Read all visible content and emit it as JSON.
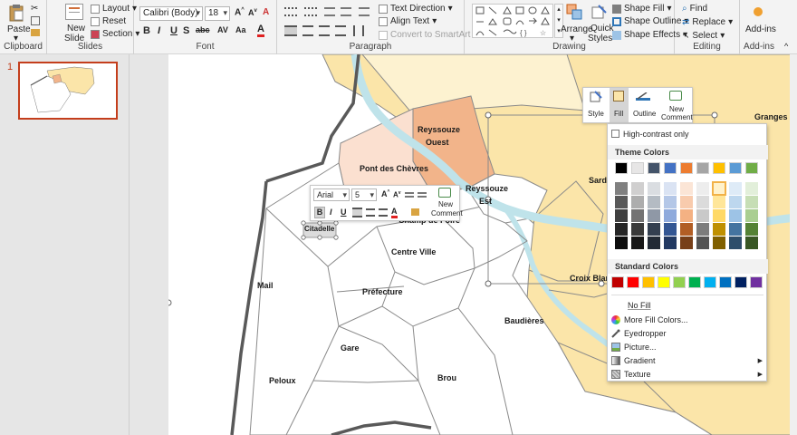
{
  "ribbon": {
    "clipboard": {
      "label": "Clipboard",
      "paste": "Paste"
    },
    "slides": {
      "label": "Slides",
      "new_slide_1": "New",
      "new_slide_2": "Slide",
      "layout": "Layout",
      "reset": "Reset",
      "section": "Section"
    },
    "font": {
      "label": "Font",
      "font_name": "Calibri (Body)",
      "font_size": "18"
    },
    "paragraph": {
      "label": "Paragraph",
      "text_direction": "Text Direction",
      "align_text": "Align Text",
      "convert_smartart": "Convert to SmartArt"
    },
    "drawing": {
      "label": "Drawing",
      "arrange": "Arrange",
      "quick_styles_1": "Quick",
      "quick_styles_2": "Styles",
      "shape_fill": "Shape Fill",
      "shape_outline": "Shape Outline",
      "shape_effects": "Shape Effects"
    },
    "editing": {
      "label": "Editing",
      "find": "Find",
      "replace": "Replace",
      "select": "Select"
    },
    "addins": {
      "label": "Add-ins",
      "addins": "Add-ins"
    }
  },
  "thumbnails": {
    "slide_number": "1"
  },
  "map": {
    "districts": {
      "reyssouze_ouest_1": "Reyssouze",
      "reyssouze_ouest_2": "Ouest",
      "pont_des_chevres": "Pont des Chèvres",
      "reyssouze_est_1": "Reyssouze",
      "reyssouze_est_2": "Est",
      "champ_de_foire": "Champ de Foire",
      "citadelle": "Citadelle",
      "centre_ville": "Centre Ville",
      "mail": "Mail",
      "prefecture": "Préfecture",
      "croix_blanche": "Croix Blan",
      "baudieres": "Baudières",
      "gare": "Gare",
      "peloux": "Peloux",
      "brou": "Brou",
      "granges": "Granges",
      "sardieres": "Sardi"
    }
  },
  "mini_toolbar": {
    "font_name": "Arial",
    "font_size": "5",
    "new_comment_1": "New",
    "new_comment_2": "Comment"
  },
  "shape_toolbar": {
    "style": "Style",
    "fill": "Fill",
    "outline": "Outline",
    "new_comment_1": "New",
    "new_comment_2": "Comment"
  },
  "fill_menu": {
    "high_contrast": "High-contrast only",
    "theme_colors": "Theme Colors",
    "standard_colors": "Standard Colors",
    "no_fill": "No Fill",
    "more_fill_colors": "More Fill Colors...",
    "eyedropper": "Eyedropper",
    "picture": "Picture...",
    "gradient": "Gradient",
    "texture": "Texture",
    "theme_top": [
      "#000000",
      "#e7e6e6",
      "#44546a",
      "#4472c4",
      "#ed7d31",
      "#a5a5a5",
      "#ffc000",
      "#5b9bd5",
      "#70ad47"
    ],
    "standard": [
      "#c00000",
      "#ff0000",
      "#ffc000",
      "#ffff00",
      "#92d050",
      "#00b050",
      "#00b0f0",
      "#0070c0",
      "#002060",
      "#7030a0"
    ]
  }
}
